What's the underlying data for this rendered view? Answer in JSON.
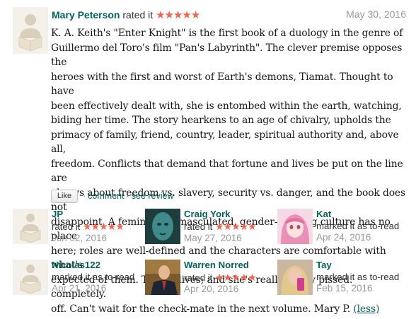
{
  "review": {
    "reviewer": "Mary Peterson",
    "action": "rated it",
    "stars": "★★★★★",
    "date": "May 30, 2016",
    "lines": [
      "K. A. Keith's \"Enter Knight\" is the first book of a duology in the genre of",
      "Guillermo del Toro's film \"Pan's Labyrinth\". The clever premise opposes the",
      "heroes with the first and worst of Earth's demons, Tiamat. Thought to have",
      "been effectively dealt with, she is entombed within the earth, watching,",
      "biding her time. The story hearkens to an age of chivalry, upholds the",
      "primacy of family, friend, country, leader, spiritual authority and, above all,",
      "freedom. Conflicts that demand that fortune and lives be put on the line are",
      "always about freedom vs. slavery, security vs. danger, and the book does not",
      "disappoint. A feminized, emasculated, gender-bending culture has no place",
      "here; roles are well-defined and the characters are comfortable with what's",
      "expected of them. Tiamat lives; and she's really, really pissed. completely.",
      "off. Can't wait for the check-mate in the next volume. Mary P."
    ],
    "less_label": "(less)",
    "like_label": "Like",
    "comment_label": "comment",
    "see_review_label": "see review",
    "separator": "·"
  },
  "activity": [
    {
      "name": "JP",
      "action": "rated it",
      "stars": "★★★★★",
      "date": "Jun 02, 2016",
      "avatar": "placeholder"
    },
    {
      "name": "Craig York",
      "action": "rated it",
      "stars": "★★★★★",
      "date": "May 27, 2016",
      "avatar": "statue-photo"
    },
    {
      "name": "Kat",
      "action": "marked it as to-read",
      "stars": "",
      "date": "Apr 24, 2016",
      "avatar": "anime-photo"
    },
    {
      "name": "Nicolas122",
      "action": "marked it as to-read",
      "stars": "",
      "date": "Apr 21, 2016",
      "avatar": "placeholder"
    },
    {
      "name": "Warren Norred",
      "action": "rated it",
      "stars": "★★★★★",
      "date": "Apr 20, 2016",
      "avatar": "suit-photo"
    },
    {
      "name": "Tay",
      "action": "marked it as to-read",
      "stars": "",
      "date": "Feb 15, 2016",
      "avatar": "selfie-photo"
    }
  ],
  "colors": {
    "link": "#00635d",
    "star": "#fa604a",
    "date": "#999999",
    "placeholder_bg": "#f4f1ea"
  }
}
